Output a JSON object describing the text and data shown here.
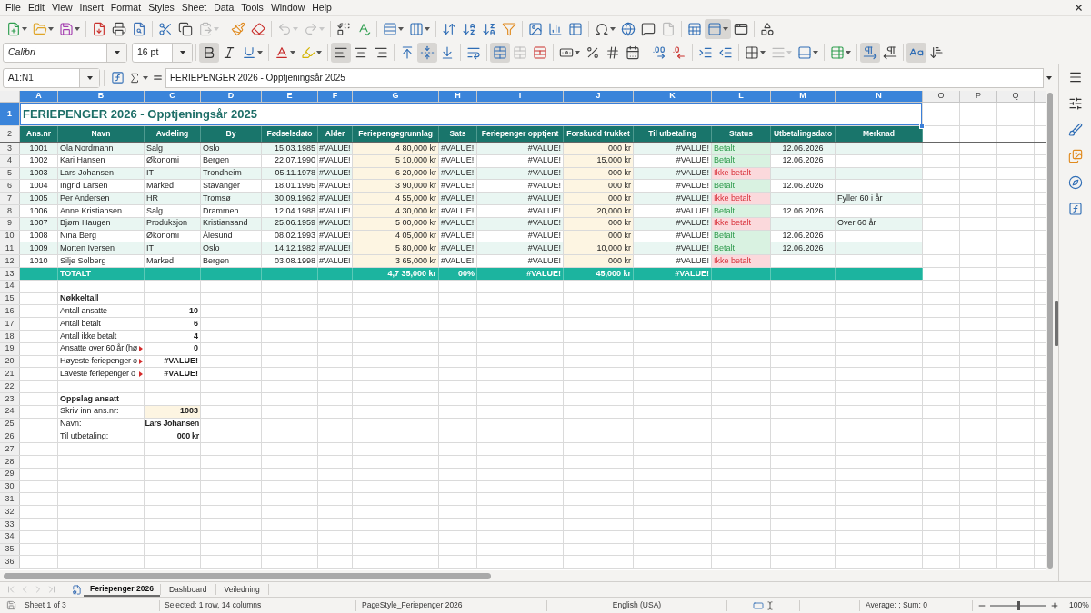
{
  "menu_bar": {
    "items": [
      "File",
      "Edit",
      "View",
      "Insert",
      "Format",
      "Styles",
      "Sheet",
      "Data",
      "Tools",
      "Window",
      "Help"
    ]
  },
  "standard_toolbar": {
    "groups": [
      [
        {
          "kind": "new",
          "pressed": false,
          "disabled": false
        },
        {
          "kind": "open",
          "pressed": false,
          "disabled": false
        },
        {
          "kind": "save",
          "pressed": false,
          "disabled": false
        }
      ],
      [
        {
          "kind": "pdf",
          "pressed": false,
          "disabled": false
        },
        {
          "kind": "print",
          "pressed": false,
          "disabled": false
        },
        {
          "kind": "preview",
          "pressed": false,
          "disabled": false
        }
      ],
      [
        {
          "kind": "cut",
          "pressed": false,
          "disabled": false
        },
        {
          "kind": "copy",
          "pressed": false,
          "disabled": false
        },
        {
          "kind": "paste",
          "pressed": false,
          "disabled": true
        }
      ],
      [
        {
          "kind": "clone",
          "pressed": false,
          "disabled": false
        },
        {
          "kind": "clear",
          "pressed": false,
          "disabled": false
        }
      ],
      [
        {
          "kind": "undo",
          "pressed": false,
          "disabled": true
        },
        {
          "kind": "redo",
          "pressed": false,
          "disabled": true
        }
      ],
      [
        {
          "kind": "find",
          "pressed": false,
          "disabled": false
        },
        {
          "kind": "spelling",
          "pressed": false,
          "disabled": false
        }
      ],
      [
        {
          "kind": "row",
          "pressed": false,
          "disabled": false
        },
        {
          "kind": "column",
          "pressed": false,
          "disabled": false
        }
      ],
      [
        {
          "kind": "sort",
          "pressed": false,
          "disabled": false
        },
        {
          "kind": "ascending",
          "pressed": false,
          "disabled": false
        },
        {
          "kind": "descending",
          "pressed": false,
          "disabled": false
        },
        {
          "kind": "autofilter",
          "pressed": false,
          "disabled": false
        }
      ],
      [
        {
          "kind": "image",
          "pressed": false,
          "disabled": false
        },
        {
          "kind": "chart",
          "pressed": false,
          "disabled": false
        },
        {
          "kind": "pivot",
          "pressed": false,
          "disabled": false
        }
      ],
      [
        {
          "kind": "symbol",
          "pressed": false,
          "disabled": false
        },
        {
          "kind": "hyperlink",
          "pressed": false,
          "disabled": false
        },
        {
          "kind": "comment",
          "pressed": false,
          "disabled": false
        },
        {
          "kind": "headerfooter",
          "pressed": false,
          "disabled": true
        }
      ],
      [
        {
          "kind": "printarea",
          "pressed": false,
          "disabled": false
        },
        {
          "kind": "freeze",
          "pressed": true,
          "disabled": false
        },
        {
          "kind": "split",
          "pressed": false,
          "disabled": false
        }
      ],
      [
        {
          "kind": "draw",
          "pressed": false,
          "disabled": false
        }
      ]
    ]
  },
  "formatting_toolbar": {
    "font_name": "Calibri",
    "font_size": "16 pt",
    "groups": [
      [
        {
          "kind": "bold",
          "pressed": true,
          "disabled": false
        },
        {
          "kind": "italic",
          "pressed": false,
          "disabled": false
        },
        {
          "kind": "underline",
          "pressed": false,
          "disabled": false
        }
      ],
      [
        {
          "kind": "fontcolor",
          "pressed": false,
          "disabled": false
        },
        {
          "kind": "highlight",
          "pressed": false,
          "disabled": false
        }
      ],
      [
        {
          "kind": "left",
          "pressed": true,
          "disabled": false
        },
        {
          "kind": "center",
          "pressed": false,
          "disabled": false
        },
        {
          "kind": "right",
          "pressed": false,
          "disabled": false
        }
      ],
      [
        {
          "kind": "top",
          "pressed": false,
          "disabled": false
        },
        {
          "kind": "middle",
          "pressed": true,
          "disabled": false
        },
        {
          "kind": "bottom",
          "pressed": false,
          "disabled": false
        }
      ],
      [
        {
          "kind": "wrap",
          "pressed": false,
          "disabled": false
        }
      ],
      [
        {
          "kind": "mergecenter",
          "pressed": true,
          "disabled": false
        },
        {
          "kind": "merge",
          "pressed": false,
          "disabled": true
        },
        {
          "kind": "unmerge",
          "pressed": false,
          "disabled": false
        }
      ],
      [
        {
          "kind": "currency",
          "pressed": false,
          "disabled": false
        },
        {
          "kind": "percent",
          "pressed": false,
          "disabled": false
        },
        {
          "kind": "number",
          "pressed": false,
          "disabled": false
        },
        {
          "kind": "date",
          "pressed": false,
          "disabled": false
        }
      ],
      [
        {
          "kind": "adddecimal",
          "pressed": false,
          "disabled": false
        },
        {
          "kind": "deldecimal",
          "pressed": false,
          "disabled": false
        }
      ],
      [
        {
          "kind": "indent",
          "pressed": false,
          "disabled": false
        },
        {
          "kind": "outdent",
          "pressed": false,
          "disabled": false
        }
      ],
      [
        {
          "kind": "borders",
          "pressed": false,
          "disabled": false
        },
        {
          "kind": "borderstyle",
          "pressed": false,
          "disabled": true
        },
        {
          "kind": "bordercolor",
          "pressed": false,
          "disabled": false
        }
      ],
      [
        {
          "kind": "conditional",
          "pressed": false,
          "disabled": false
        }
      ],
      [
        {
          "kind": "ltr",
          "pressed": true,
          "disabled": false
        },
        {
          "kind": "rtl",
          "pressed": false,
          "disabled": false
        }
      ],
      [
        {
          "kind": "horizontal",
          "pressed": true,
          "disabled": false
        },
        {
          "kind": "vertical",
          "pressed": false,
          "disabled": false
        }
      ]
    ]
  },
  "formula_bar": {
    "name_box": "A1:N1",
    "formula": "FERIEPENGER 2026 - Opptjeningsår 2025"
  },
  "sheet": {
    "column_headers": [
      {
        "label": "A",
        "selected": true
      },
      {
        "label": "B",
        "selected": true
      },
      {
        "label": "C",
        "selected": true
      },
      {
        "label": "D",
        "selected": true
      },
      {
        "label": "E",
        "selected": true
      },
      {
        "label": "F",
        "selected": true
      },
      {
        "label": "G",
        "selected": true
      },
      {
        "label": "H",
        "selected": true
      },
      {
        "label": "I",
        "selected": true
      },
      {
        "label": "J",
        "selected": true
      },
      {
        "label": "K",
        "selected": true
      },
      {
        "label": "L",
        "selected": true
      },
      {
        "label": "M",
        "selected": true
      },
      {
        "label": "N",
        "selected": true
      },
      {
        "label": "O",
        "selected": false
      },
      {
        "label": "P",
        "selected": false
      },
      {
        "label": "Q",
        "selected": false
      }
    ],
    "row_headers": [
      {
        "label": "1",
        "selected": true
      },
      {
        "label": "2",
        "selected": false
      },
      {
        "label": "3",
        "selected": false
      },
      {
        "label": "4",
        "selected": false
      },
      {
        "label": "5",
        "selected": false
      },
      {
        "label": "6",
        "selected": false
      },
      {
        "label": "7",
        "selected": false
      },
      {
        "label": "8",
        "selected": false
      },
      {
        "label": "9",
        "selected": false
      },
      {
        "label": "10",
        "selected": false
      },
      {
        "label": "11",
        "selected": false
      },
      {
        "label": "12",
        "selected": false
      },
      {
        "label": "13",
        "selected": false
      },
      {
        "label": "14",
        "selected": false
      },
      {
        "label": "15",
        "selected": false
      },
      {
        "label": "16",
        "selected": false
      },
      {
        "label": "17",
        "selected": false
      },
      {
        "label": "18",
        "selected": false
      },
      {
        "label": "19",
        "selected": false
      },
      {
        "label": "20",
        "selected": false
      },
      {
        "label": "21",
        "selected": false
      },
      {
        "label": "22",
        "selected": false
      },
      {
        "label": "23",
        "selected": false
      },
      {
        "label": "24",
        "selected": false
      },
      {
        "label": "25",
        "selected": false
      },
      {
        "label": "26",
        "selected": false
      },
      {
        "label": "27",
        "selected": false
      },
      {
        "label": "28",
        "selected": false
      },
      {
        "label": "29",
        "selected": false
      },
      {
        "label": "30",
        "selected": false
      },
      {
        "label": "31",
        "selected": false
      },
      {
        "label": "32",
        "selected": false
      },
      {
        "label": "33",
        "selected": false
      },
      {
        "label": "34",
        "selected": false
      },
      {
        "label": "35",
        "selected": false
      },
      {
        "label": "36",
        "selected": false
      }
    ],
    "title": "FERIEPENGER 2026 - Opptjeningsår 2025",
    "table": {
      "columns": [
        "Ans.nr",
        "Navn",
        "Avdeling",
        "By",
        "Fødselsdato",
        "Alder",
        "Feriepengegrunnlag",
        "Sats",
        "Feriepenger opptjent",
        "Forskudd trukket",
        "Til utbetaling",
        "Status",
        "Utbetalingsdato",
        "Merknad"
      ],
      "rows": [
        {
          "ans_nr": "1001",
          "navn": "Ola Nordmann",
          "avdeling": "Salg",
          "by": "Oslo",
          "fodselsdato": "15.03.1985",
          "alder": "#VALUE!",
          "grunnlag": "4 80,000 kr",
          "sats": "#VALUE!",
          "opptjent": "#VALUE!",
          "forskudd": "000 kr",
          "til_utbetaling": "#VALUE!",
          "status": {
            "text": "Betalt",
            "paid": true
          },
          "utbetalingsdato": "12.06.2026"
        },
        {
          "ans_nr": "1002",
          "navn": "Kari Hansen",
          "avdeling": "Økonomi",
          "by": "Bergen",
          "fodselsdato": "22.07.1990",
          "alder": "#VALUE!",
          "grunnlag": "5 10,000 kr",
          "sats": "#VALUE!",
          "opptjent": "#VALUE!",
          "forskudd": "15,000 kr",
          "til_utbetaling": "#VALUE!",
          "status": {
            "text": "Betalt",
            "paid": true
          },
          "utbetalingsdato": "12.06.2026"
        },
        {
          "ans_nr": "1003",
          "navn": "Lars Johansen",
          "avdeling": "IT",
          "by": "Trondheim",
          "fodselsdato": "05.11.1978",
          "alder": "#VALUE!",
          "grunnlag": "6 20,000 kr",
          "sats": "#VALUE!",
          "opptjent": "#VALUE!",
          "forskudd": "000 kr",
          "til_utbetaling": "#VALUE!",
          "status": {
            "text": "Ikke betalt",
            "paid": false
          }
        },
        {
          "ans_nr": "1004",
          "navn": "Ingrid Larsen",
          "avdeling": "Marked",
          "by": "Stavanger",
          "fodselsdato": "18.01.1995",
          "alder": "#VALUE!",
          "grunnlag": "3 90,000 kr",
          "sats": "#VALUE!",
          "opptjent": "#VALUE!",
          "forskudd": "000 kr",
          "til_utbetaling": "#VALUE!",
          "status": {
            "text": "Betalt",
            "paid": true
          },
          "utbetalingsdato": "12.06.2026"
        },
        {
          "ans_nr": "1005",
          "navn": "Per Andersen",
          "avdeling": "HR",
          "by": "Tromsø",
          "fodselsdato": "30.09.1962",
          "alder": "#VALUE!",
          "grunnlag": "4 55,000 kr",
          "sats": "#VALUE!",
          "opptjent": "#VALUE!",
          "forskudd": "000 kr",
          "til_utbetaling": "#VALUE!",
          "status": {
            "text": "Ikke betalt",
            "paid": false
          },
          "merknad": "Fyller 60 i år"
        },
        {
          "ans_nr": "1006",
          "navn": "Anne Kristiansen",
          "avdeling": "Salg",
          "by": "Drammen",
          "fodselsdato": "12.04.1988",
          "alder": "#VALUE!",
          "grunnlag": "4 30,000 kr",
          "sats": "#VALUE!",
          "opptjent": "#VALUE!",
          "forskudd": "20,000 kr",
          "til_utbetaling": "#VALUE!",
          "status": {
            "text": "Betalt",
            "paid": true
          },
          "utbetalingsdato": "12.06.2026"
        },
        {
          "ans_nr": "1007",
          "navn": "Bjørn Haugen",
          "avdeling": "Produksjon",
          "by": "Kristiansand",
          "fodselsdato": "25.06.1959",
          "alder": "#VALUE!",
          "grunnlag": "5 00,000 kr",
          "sats": "#VALUE!",
          "opptjent": "#VALUE!",
          "forskudd": "000 kr",
          "til_utbetaling": "#VALUE!",
          "status": {
            "text": "Ikke betalt",
            "paid": false
          },
          "merknad": "Over 60 år"
        },
        {
          "ans_nr": "1008",
          "navn": "Nina Berg",
          "avdeling": "Økonomi",
          "by": "Ålesund",
          "fodselsdato": "08.02.1993",
          "alder": "#VALUE!",
          "grunnlag": "4 05,000 kr",
          "sats": "#VALUE!",
          "opptjent": "#VALUE!",
          "forskudd": "000 kr",
          "til_utbetaling": "#VALUE!",
          "status": {
            "text": "Betalt",
            "paid": true
          },
          "utbetalingsdato": "12.06.2026"
        },
        {
          "ans_nr": "1009",
          "navn": "Morten Iversen",
          "avdeling": "IT",
          "by": "Oslo",
          "fodselsdato": "14.12.1982",
          "alder": "#VALUE!",
          "grunnlag": "5 80,000 kr",
          "sats": "#VALUE!",
          "opptjent": "#VALUE!",
          "forskudd": "10,000 kr",
          "til_utbetaling": "#VALUE!",
          "status": {
            "text": "Betalt",
            "paid": true
          },
          "utbetalingsdato": "12.06.2026"
        },
        {
          "ans_nr": "1010",
          "navn": "Silje Solberg",
          "avdeling": "Marked",
          "by": "Bergen",
          "fodselsdato": "03.08.1998",
          "alder": "#VALUE!",
          "grunnlag": "3 65,000 kr",
          "sats": "#VALUE!",
          "opptjent": "#VALUE!",
          "forskudd": "000 kr",
          "til_utbetaling": "#VALUE!",
          "status": {
            "text": "Ikke betalt",
            "paid": false
          }
        }
      ],
      "totals": {
        "label": "TOTALT",
        "grunnlag": "4,7 35,000 kr",
        "sats": "00%",
        "opptjent": "#VALUE!",
        "forskudd": "45,000 kr",
        "til_utbetaling": "#VALUE!"
      }
    },
    "key_figures": {
      "heading": "Nøkkeltall",
      "items": [
        {
          "label": "Antall ansatte",
          "value": "10",
          "clipped": false
        },
        {
          "label": "Antall betalt",
          "value": "6",
          "clipped": false
        },
        {
          "label": "Antall ikke betalt",
          "value": "4",
          "clipped": false
        },
        {
          "label": "Ansatte over 60 år (hø",
          "value": "0",
          "clipped": true
        },
        {
          "label": "Høyeste feriepenger o",
          "value": "#VALUE!",
          "clipped": true
        },
        {
          "label": "Laveste feriepenger o",
          "value": "#VALUE!",
          "clipped": true
        }
      ]
    },
    "lookup": {
      "heading": "Oppslag ansatt",
      "items": [
        {
          "label": "Skriv inn ans.nr:",
          "value": "1003",
          "kind": "input"
        },
        {
          "label": "Navn:",
          "value": "Lars Johansen",
          "kind": "output"
        },
        {
          "label": "Til utbetaling:",
          "value": "000 kr",
          "kind": "output"
        }
      ]
    }
  },
  "sheet_tabs": {
    "navigation_disabled": true,
    "tabs": [
      {
        "label": "Feriepenger 2026",
        "selected": true
      },
      {
        "label": "Dashboard",
        "selected": false
      },
      {
        "label": "Veiledning",
        "selected": false
      }
    ]
  },
  "status_bar": {
    "sheet": "Sheet 1 of 3",
    "selection": "Selected: 1 row, 14 columns",
    "page_style": "PageStyle_Feriepenger 2026",
    "language": "English (USA)",
    "summary": "Average: ; Sum: 0",
    "zoom": {
      "level": 0.5,
      "reading": "100%"
    }
  }
}
